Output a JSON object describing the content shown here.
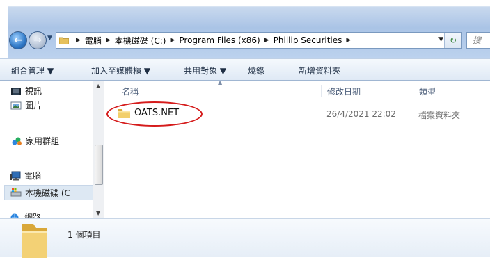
{
  "address": {
    "crumbs": [
      "電腦",
      "本機磁碟 (C:)",
      "Program Files (x86)",
      "Phillip Securities"
    ],
    "search_placeholder": "搜"
  },
  "toolbar": {
    "organize": "組合管理 ▼",
    "add_to_library": "加入至媒體櫃 ▼",
    "share_with": "共用對象 ▼",
    "burn": "燒錄",
    "new_folder": "新增資料夾"
  },
  "nav": {
    "items": [
      {
        "label": "視訊",
        "icon": "video-icon"
      },
      {
        "label": "圖片",
        "icon": "pictures-icon"
      },
      {
        "label": "家用群組",
        "icon": "homegroup-icon"
      },
      {
        "label": "電腦",
        "icon": "computer-icon"
      },
      {
        "label": "本機磁碟 (C",
        "icon": "local-disk-icon"
      },
      {
        "label": "網路",
        "icon": "network-icon"
      }
    ]
  },
  "columns": {
    "name": "名稱",
    "modified": "修改日期",
    "type": "類型"
  },
  "files": [
    {
      "name": "OATS.NET",
      "modified": "26/4/2021 22:02",
      "type": "檔案資料夾",
      "icon": "folder-icon"
    }
  ],
  "details": {
    "item_count": "1 個項目"
  },
  "colors": {
    "highlight_ellipse": "#d51b1b",
    "toolbar_bg": "#dfe9f5",
    "address_band": "#aac4e6"
  }
}
